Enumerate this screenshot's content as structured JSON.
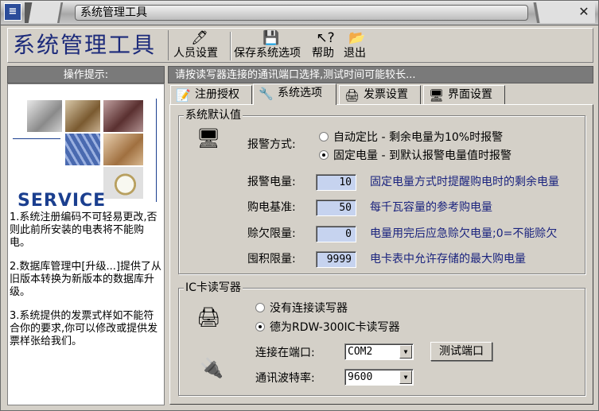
{
  "window": {
    "title": "系统管理工具"
  },
  "toolbar": {
    "brand": "系统管理工具",
    "buttons": [
      {
        "label": "人员设置",
        "icon": "person-icon"
      },
      {
        "label": "保存系统选项",
        "icon": "save-disk-icon"
      },
      {
        "label": "帮助",
        "icon": "help-arrow-icon"
      },
      {
        "label": "退出",
        "icon": "exit-folder-icon"
      }
    ]
  },
  "left": {
    "header": "操作提示:",
    "service_text": "SERVICE",
    "tips": [
      "1.系统注册编码不可轻易更改,否则此前所安装的电表将不能购电。",
      "2.数据库管理中[升级...]提供了从旧版本转换为新版本的数据库升级。",
      "3.系统提供的发票式样如不能符合你的要求,你可以修改或提供发票样张给我们。"
    ]
  },
  "hint": "请按读写器连接的通讯端口选择,测试时间可能较长...",
  "tabs": [
    {
      "label": "注册授权",
      "icon": "register-icon"
    },
    {
      "label": "系统选项",
      "icon": "options-icon",
      "active": true
    },
    {
      "label": "发票设置",
      "icon": "printer-icon"
    },
    {
      "label": "界面设置",
      "icon": "screen-icon"
    }
  ],
  "defaults": {
    "title": "系统默认值",
    "alarm_label": "报警方式:",
    "alarm_options": [
      {
        "label": "自动定比 - 剩余电量为10%时报警",
        "selected": false
      },
      {
        "label": "固定电量 - 到默认报警电量值时报警",
        "selected": true
      }
    ],
    "fields": [
      {
        "label": "报警电量:",
        "value": "10",
        "desc": "固定电量方式时提醒购电时的剩余电量"
      },
      {
        "label": "购电基准:",
        "value": "50",
        "desc": "每千瓦容量的参考购电量"
      },
      {
        "label": "赊欠限量:",
        "value": "0",
        "desc": "电量用完后应急赊欠电量;0=不能赊欠"
      },
      {
        "label": "囤积限量:",
        "value": "9999",
        "desc": "电卡表中允许存储的最大购电量"
      }
    ]
  },
  "reader": {
    "title": "IC卡读写器",
    "options": [
      {
        "label": "没有连接读写器",
        "selected": false
      },
      {
        "label": "德为RDW-300IC卡读写器",
        "selected": true
      }
    ],
    "port_label": "连接在端口:",
    "port_value": "COM2",
    "test_button": "测试端口",
    "baud_label": "通讯波特率:",
    "baud_value": "9600"
  }
}
